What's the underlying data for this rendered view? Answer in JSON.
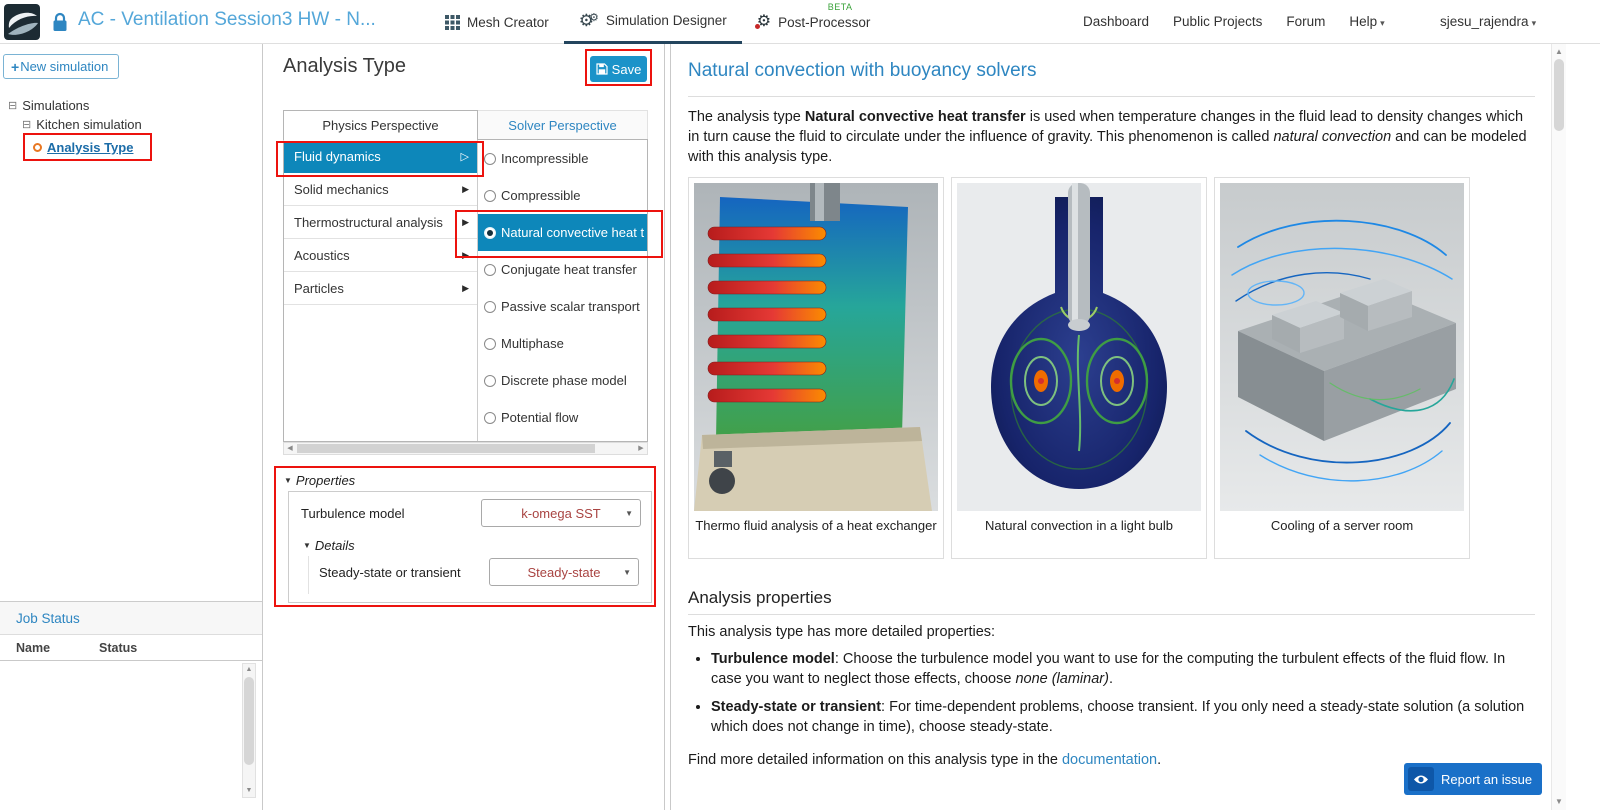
{
  "colors": {
    "accent": "#0d87ba",
    "link": "#2e86c1",
    "annotation": "#ec130e",
    "header_title": "#54a7d9",
    "beta": "#3aa23a",
    "save": "#1b93c9",
    "report": "#1a70c8",
    "report_dark": "#0e57a8",
    "select_text": "#a94442"
  },
  "icons": {
    "plus": "+",
    "caret_down": "▾",
    "tree_minus": "⊟",
    "section_collapse": "▼",
    "submenu": "▶",
    "submenu_open": "▷",
    "gear": "⚙",
    "select_caret": "▼",
    "scroll_up": "▲",
    "scroll_down": "▼",
    "scroll_left": "◀",
    "scroll_right": "▶"
  },
  "header": {
    "title": "AC - Ventilation Session3 HW - N...",
    "nav": [
      {
        "label": "Mesh Creator"
      },
      {
        "label": "Simulation Designer"
      },
      {
        "label": "Post-Processor",
        "badge": "BETA"
      }
    ],
    "links": {
      "dashboard": "Dashboard",
      "public_projects": "Public Projects",
      "forum": "Forum",
      "help": "Help",
      "user": "sjesu_rajendra"
    }
  },
  "sidebar": {
    "new_simulation": "New simulation",
    "tree": {
      "root": "Simulations",
      "child": "Kitchen simulation",
      "leaf": "Analysis Type"
    },
    "job_status": {
      "title": "Job Status",
      "columns": [
        "Name",
        "Status"
      ]
    }
  },
  "panel": {
    "title": "Analysis Type",
    "save": "Save",
    "tabs": [
      "Physics Perspective",
      "Solver Perspective"
    ],
    "physics": [
      {
        "label": "Fluid dynamics",
        "selected": true
      },
      {
        "label": "Solid mechanics"
      },
      {
        "label": "Thermostructural analysis"
      },
      {
        "label": "Acoustics"
      },
      {
        "label": "Particles"
      }
    ],
    "solvers": [
      {
        "label": "Incompressible"
      },
      {
        "label": "Compressible"
      },
      {
        "label": "Natural convective heat t",
        "selected": true
      },
      {
        "label": "Conjugate heat transfer"
      },
      {
        "label": "Passive scalar transport"
      },
      {
        "label": "Multiphase"
      },
      {
        "label": "Discrete phase model"
      },
      {
        "label": "Potential flow"
      }
    ],
    "properties": {
      "section": "Properties",
      "turbulence_label": "Turbulence model",
      "turbulence_value": "k-omega SST",
      "details": "Details",
      "steady_label": "Steady-state or transient",
      "steady_value": "Steady-state"
    }
  },
  "doc": {
    "title": "Natural convection with buoyancy solvers",
    "intro": {
      "s1": "The analysis type ",
      "s2": "Natural convective heat transfer",
      "s3": " is used when temperature changes in the fluid lead to density changes which in turn cause the fluid to circulate under the influence of gravity. This phenomenon is called ",
      "s4": "natural convection",
      "s5": " and can be modeled with this analysis type."
    },
    "cards": [
      {
        "caption": "Thermo fluid analysis of a heat exchanger"
      },
      {
        "caption": "Natural convection in a light bulb"
      },
      {
        "caption": "Cooling of a server room"
      }
    ],
    "properties_heading": "Analysis properties",
    "properties_lead": "This analysis type has more detailed properties:",
    "bullets": [
      {
        "b": "Turbulence model",
        "t1": ": Choose the turbulence model you want to use for the computing the turbulent effects of the fluid flow. In case you want to neglect those effects, choose ",
        "i": "none (laminar)",
        "t2": "."
      },
      {
        "b": "Steady-state or transient",
        "t1": ": For time-dependent problems, choose transient. If you only need a steady-state solution (a solution which does not change in time), choose steady-state.",
        "i": "",
        "t2": ""
      }
    ],
    "footer": {
      "t1": "Find more detailed information on this analysis type in the ",
      "link": "documentation",
      "t2": "."
    },
    "report_issue": "Report an issue"
  }
}
